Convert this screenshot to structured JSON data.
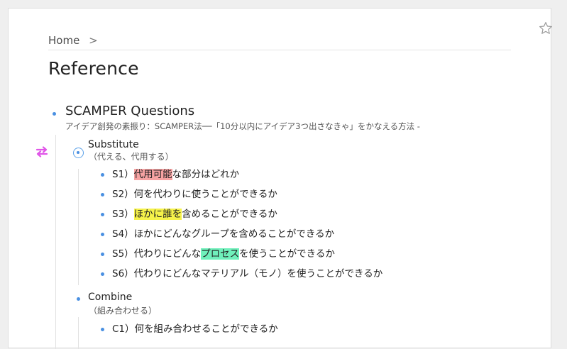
{
  "breadcrumb": {
    "home": "Home",
    "separator": ">"
  },
  "page_title": "Reference",
  "root": {
    "title": "SCAMPER Questions",
    "note": "アイデア創発の素振り：SCAMPER法──「10分以内にアイデア3つ出さなきゃ」をかなえる方法 -"
  },
  "sections": [
    {
      "title": "Substitute",
      "note": "（代える、代用する）",
      "items": [
        {
          "before": "S1）",
          "highlight": "代用可能",
          "after": "な部分はどれか",
          "color": "#f7a3a3"
        },
        {
          "before": "S2）何を代わりに使うことができるか",
          "highlight": "",
          "after": ""
        },
        {
          "before": "S3）",
          "highlight": "ほかに誰を",
          "after": "含めることができるか",
          "color": "#f6f24a"
        },
        {
          "before": "S4）ほかにどんなグループを含めることができるか",
          "highlight": "",
          "after": ""
        },
        {
          "before": "S5）代わりにどんな",
          "highlight": "プロセス",
          "after": "を使うことができるか",
          "color": "#6ff0bb"
        },
        {
          "before": "S6）代わりにどんなマテリアル（モノ）を使うことができるか",
          "highlight": "",
          "after": ""
        }
      ]
    },
    {
      "title": "Combine",
      "note": "（組み合わせる）",
      "items": [
        {
          "before": "C1）何を組み合わせることができるか",
          "highlight": "",
          "after": ""
        }
      ]
    }
  ],
  "icons": {
    "star": "star-icon",
    "move": "move-arrows-icon",
    "bullet_color": "#4a90e2"
  }
}
